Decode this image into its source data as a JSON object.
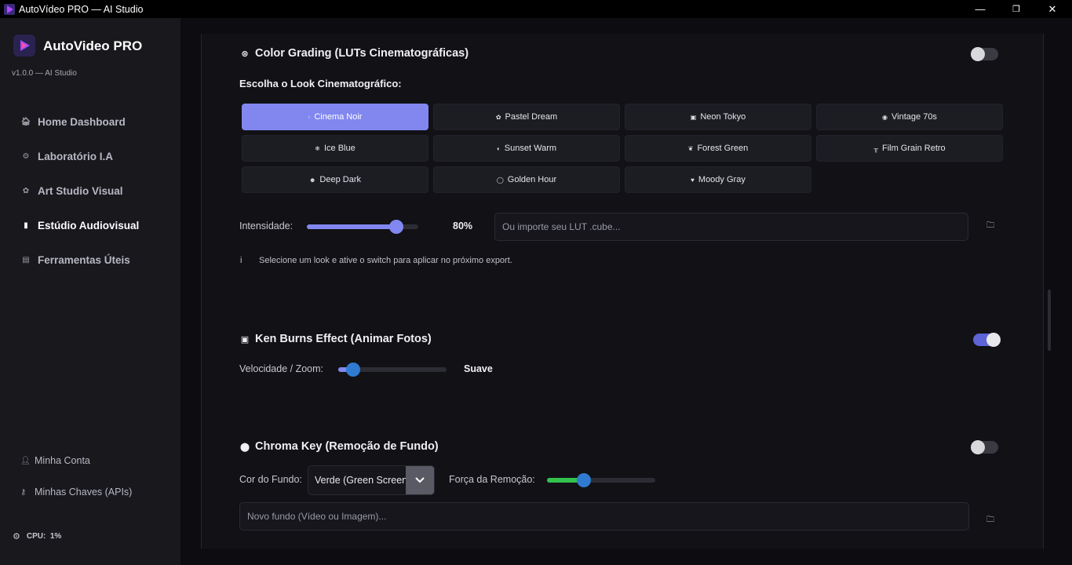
{
  "window": {
    "title": "AutoVídeo PRO — AI Studio",
    "minimize": "—",
    "maximize": "❐",
    "close": "✕"
  },
  "sidebar": {
    "brand_name": "AutoVideo PRO",
    "version": "v1.0.0 — AI Studio",
    "items": [
      {
        "label": "Home Dashboard",
        "icon": "home-icon",
        "glyph": "🏠︎"
      },
      {
        "label": "Laboratório I.A",
        "icon": "brain-icon",
        "glyph": "⚙︎"
      },
      {
        "label": "Art Studio Visual",
        "icon": "palette-icon",
        "glyph": "✿"
      },
      {
        "label": "Estúdio Audiovisual",
        "icon": "clapper-icon",
        "glyph": "▮"
      },
      {
        "label": "Ferramentas Úteis",
        "icon": "toolbox-icon",
        "glyph": "▤"
      }
    ],
    "active": "Estúdio Audiovisual",
    "account": "Minha Conta",
    "api_keys": "Minhas Chaves (APIs)",
    "cpu": "CPU:  1%"
  },
  "color_grading": {
    "title": "Color Grading (LUTs Cinematográficas)",
    "enabled": false,
    "choose_label": "Escolha o Look Cinematográfico:",
    "looks": [
      {
        "label": "Cinema Noir",
        "glyph": "▫"
      },
      {
        "label": "Pastel Dream",
        "glyph": "✿"
      },
      {
        "label": "Neon Tokyo",
        "glyph": "▣"
      },
      {
        "label": "Vintage 70s",
        "glyph": "◉"
      },
      {
        "label": "Ice Blue",
        "glyph": "❄"
      },
      {
        "label": "Sunset Warm",
        "glyph": "◐"
      },
      {
        "label": "Forest Green",
        "glyph": "❦"
      },
      {
        "label": "Film Grain Retro",
        "glyph": "╥"
      },
      {
        "label": "Deep Dark",
        "glyph": "☻"
      },
      {
        "label": "Golden Hour",
        "glyph": "◯"
      },
      {
        "label": "Moody Gray",
        "glyph": "♥"
      }
    ],
    "selected_look": "Cinema Noir",
    "intensity_label": "Intensidade:",
    "intensity_value": "80%",
    "intensity_fraction": 0.8,
    "lut_placeholder": "Ou importe seu LUT .cube...",
    "info_icon": "i",
    "info_text": "Selecione um look e ative o switch para aplicar no próximo export."
  },
  "ken_burns": {
    "title": "Ken Burns Effect (Animar Fotos)",
    "enabled": true,
    "speed_label": "Velocidade / Zoom:",
    "speed_value": "Suave",
    "speed_fraction": 0.14
  },
  "chroma_key": {
    "title": "Chroma Key (Remoção de Fundo)",
    "enabled": false,
    "bg_color_label": "Cor do Fundo:",
    "bg_color_value": "Verde (Green Screen)",
    "strength_label": "Força da Remoção:",
    "strength_fraction": 0.34,
    "new_bg_placeholder": "Novo fundo (Vídeo ou Imagem)..."
  },
  "colors": {
    "accent": "#8187ef",
    "slider_thumb": "#2f7bd1",
    "green": "#33c24d"
  }
}
